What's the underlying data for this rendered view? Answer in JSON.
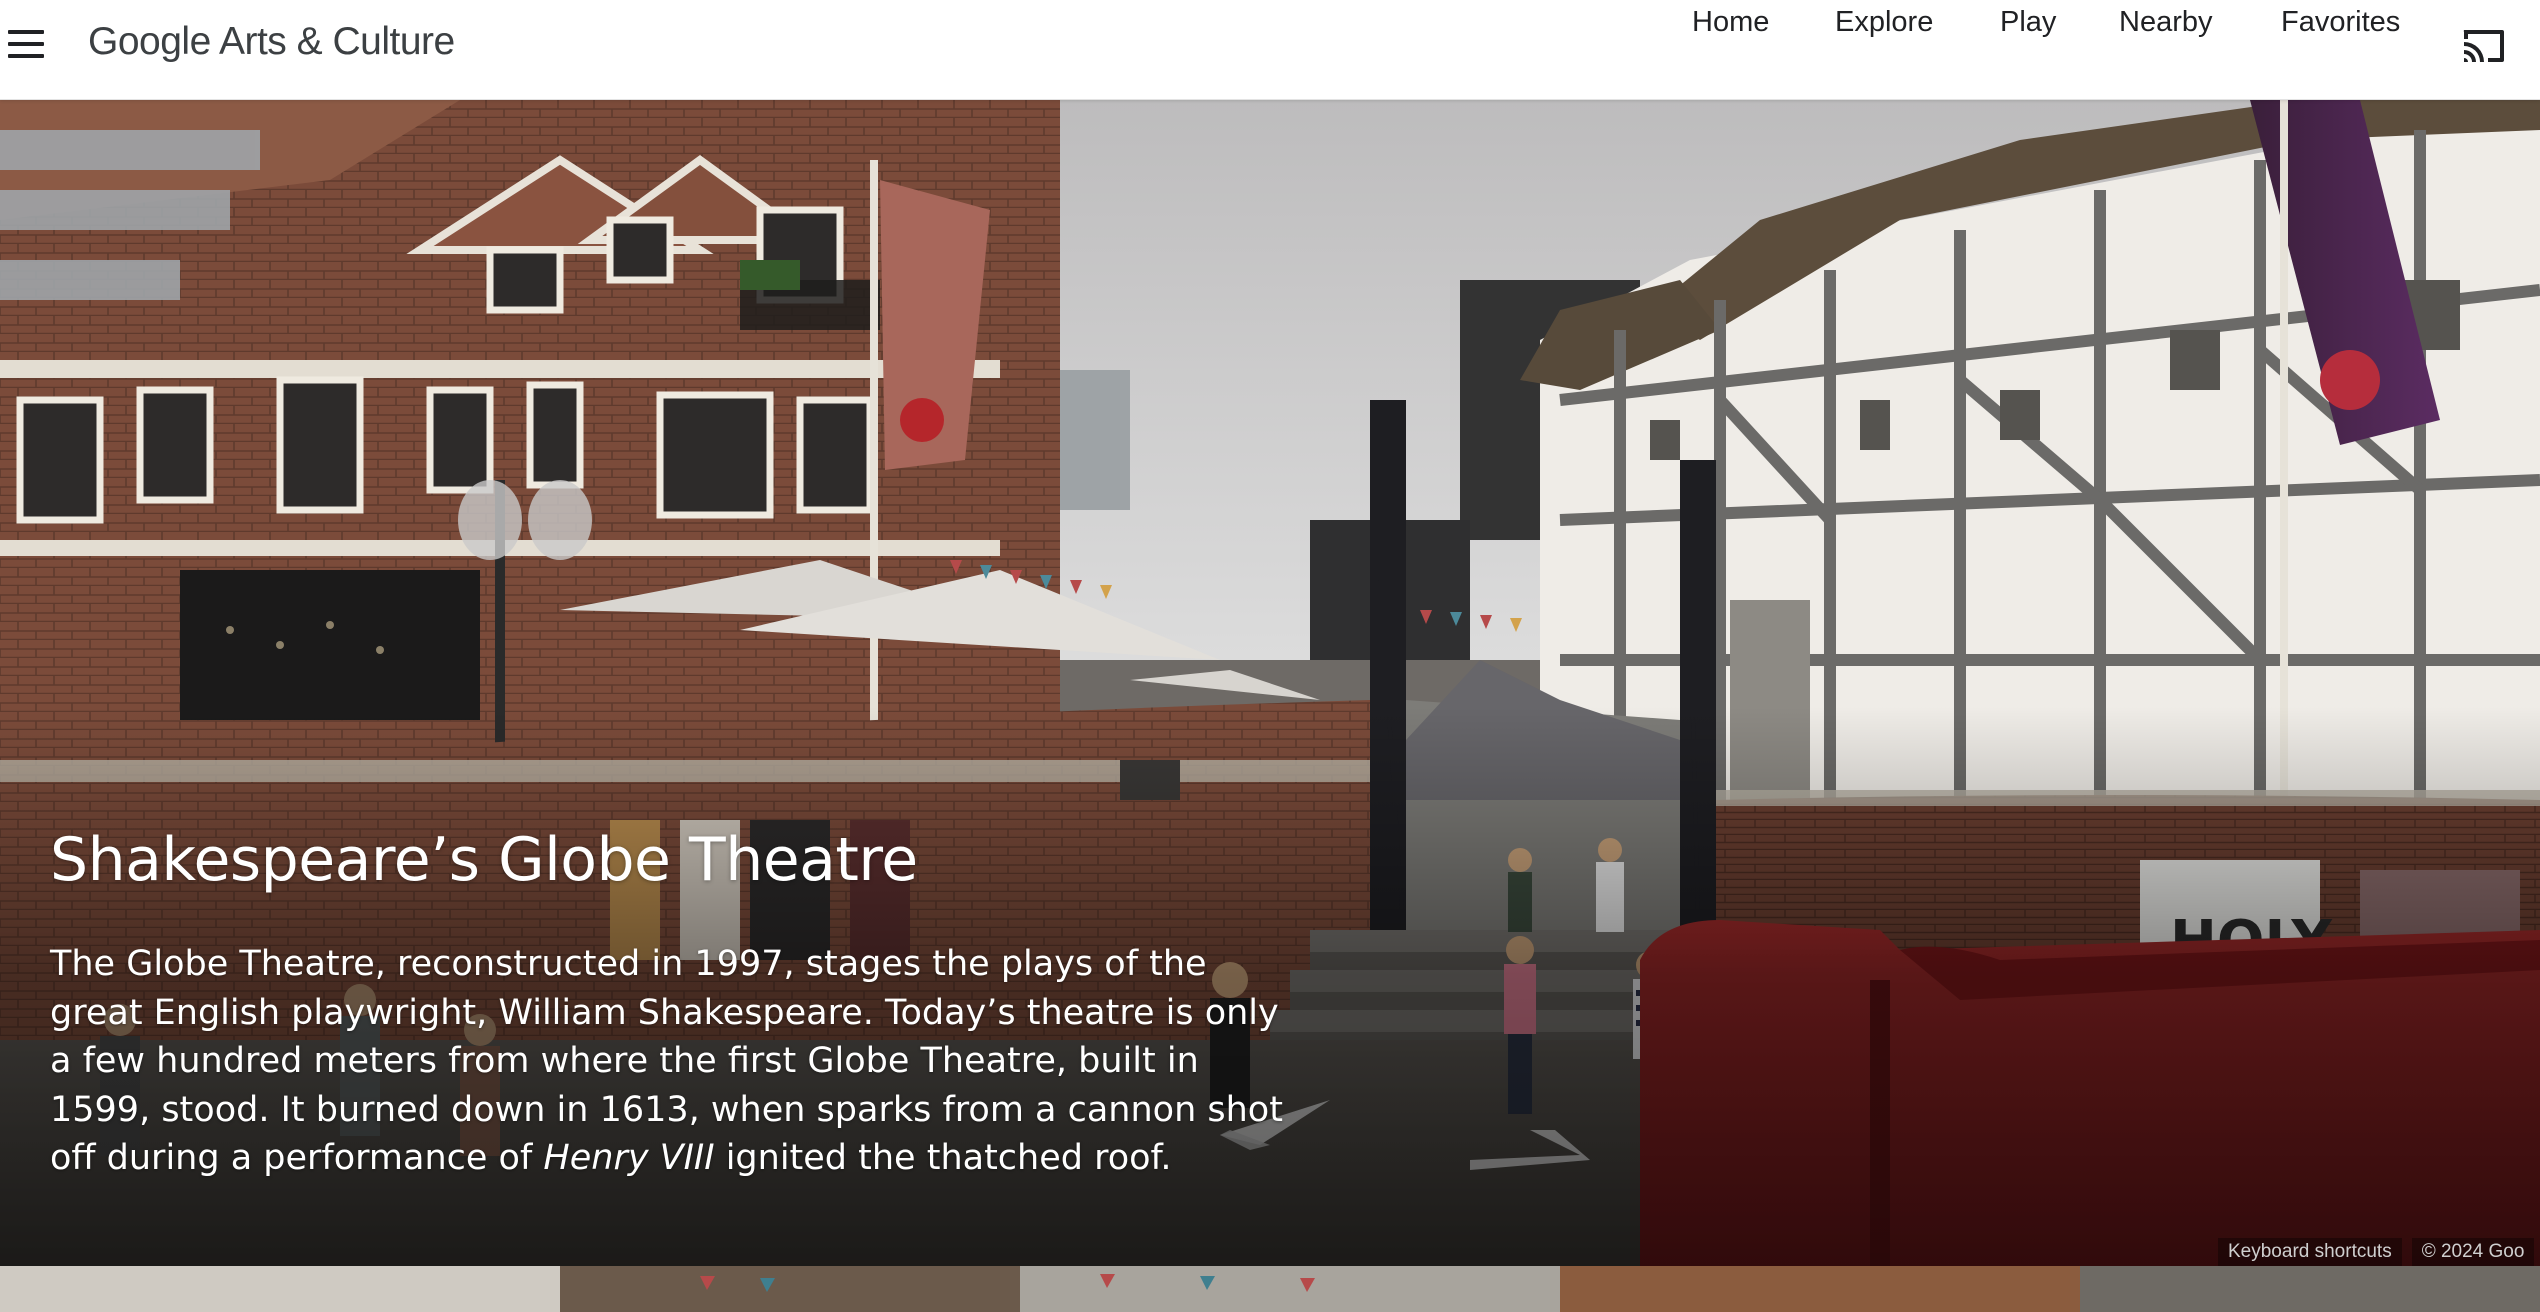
{
  "header": {
    "logo_google": "Google",
    "logo_rest": " Arts & Culture",
    "nav": [
      {
        "label": "Home"
      },
      {
        "label": "Explore"
      },
      {
        "label": "Play"
      },
      {
        "label": "Nearby"
      },
      {
        "label": "Favorites"
      }
    ],
    "menu_icon": "hamburger-menu-icon",
    "cast_icon": "cast-icon"
  },
  "hero": {
    "title": "Shakespeare’s Globe Theatre",
    "description_before": "The Globe Theatre, reconstructed in 1997, stages the plays of the great English playwright, William Shakespeare. Today’s theatre is only a few hundred meters from where the first Globe Theatre, built in 1599, stood. It burned down in 1613, when sparks from a cannon shot off during a performance of ",
    "description_italic": "Henry VIII",
    "description_after": " ignited the thatched roof.",
    "sign_text": "HOLY",
    "footer": {
      "keyboard_shortcuts": "Keyboard shortcuts",
      "copyright": "© 2024 Goo"
    }
  },
  "colors": {
    "text_dark": "#202124",
    "overlay_text": "#ffffff",
    "van_red": "#8e1f22",
    "brick": "#7a4a3a"
  }
}
